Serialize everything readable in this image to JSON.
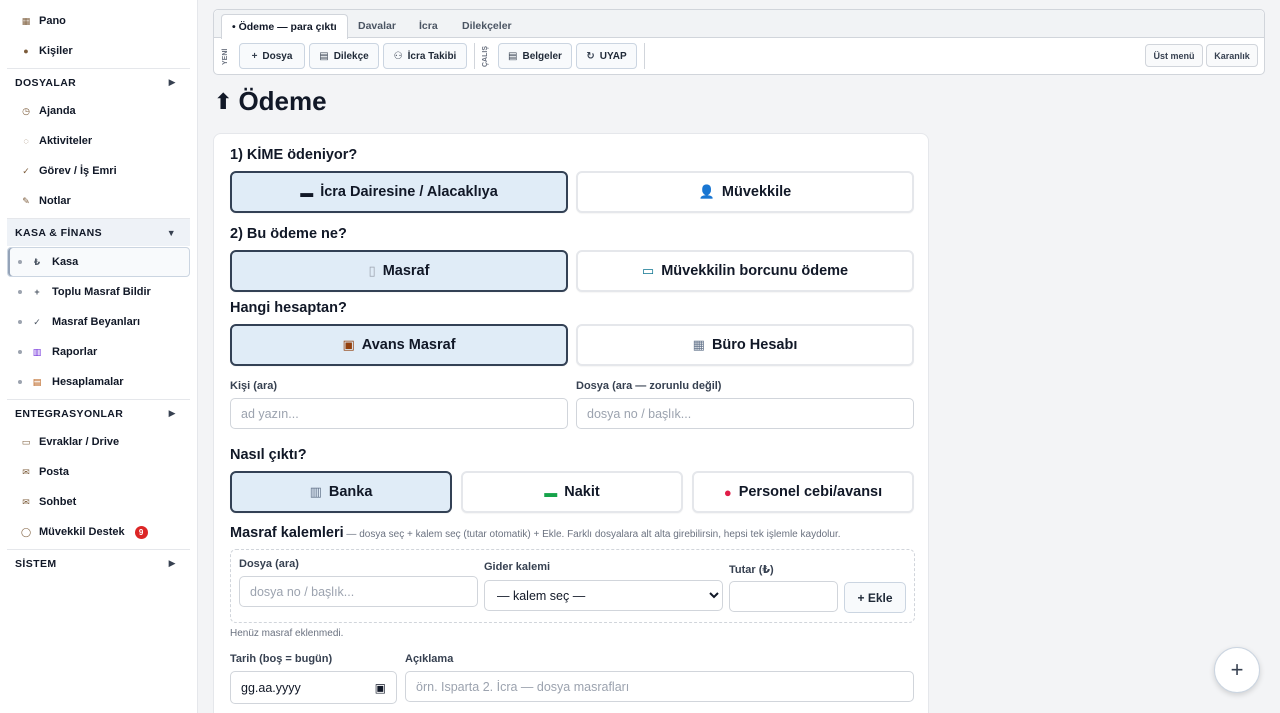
{
  "sidebar": {
    "top_items": [
      {
        "icon": "grid-icon",
        "glyph": "▦",
        "label": "Pano"
      },
      {
        "icon": "person-icon",
        "glyph": "●",
        "label": "Kişiler"
      }
    ],
    "sections": {
      "dosyalar": {
        "label": "DOSYALAR",
        "arrow": "▶"
      },
      "kasa": {
        "label": "KASA & FİNANS",
        "arrow": "▼"
      },
      "entegrasyonlar": {
        "label": "ENTEGRASYONLAR",
        "arrow": "▶"
      },
      "sistem": {
        "label": "SİSTEM",
        "arrow": "▶"
      }
    },
    "work_items": [
      {
        "icon": "clock-icon",
        "glyph": "◷",
        "label": "Ajanda"
      },
      {
        "icon": "activity-icon",
        "glyph": "◌",
        "label": "Aktiviteler"
      },
      {
        "icon": "check-icon",
        "glyph": "✓",
        "label": "Görev / İş Emri"
      },
      {
        "icon": "pencil-icon",
        "glyph": "✎",
        "label": "Notlar"
      }
    ],
    "finance_items": [
      {
        "icon": "wallet-icon",
        "glyph": "₺",
        "label": "Kasa"
      },
      {
        "icon": "plus-icon",
        "glyph": "+",
        "label": "Toplu Masraf Bildir"
      },
      {
        "icon": "check-icon",
        "glyph": "✓",
        "label": "Masraf Beyanları"
      },
      {
        "icon": "chart-icon",
        "glyph": "▥",
        "label": "Raporlar"
      },
      {
        "icon": "calculator-icon",
        "glyph": "▤",
        "label": "Hesaplamalar"
      }
    ],
    "integration_items": [
      {
        "icon": "folder-icon",
        "glyph": "▭",
        "label": "Evraklar / Drive"
      },
      {
        "icon": "mail-icon",
        "glyph": "✉",
        "label": "Posta"
      },
      {
        "icon": "chat-icon",
        "glyph": "✉",
        "label": "Sohbet"
      },
      {
        "icon": "support-icon",
        "glyph": "◯",
        "label": "Müvekkil Destek",
        "badge": "9"
      }
    ]
  },
  "topbar": {
    "tabs": [
      "• Ödeme — para çıktı",
      "Davalar",
      "İcra",
      "Dilekçeler"
    ],
    "group_labels": [
      "YENİ",
      "ÇALIŞ"
    ],
    "new_buttons": [
      {
        "icon": "plus-icon",
        "glyph": "+",
        "label": "Dosya"
      },
      {
        "icon": "document-icon",
        "glyph": "▤",
        "label": "Dilekçe"
      },
      {
        "icon": "binoculars-icon",
        "glyph": "⚇",
        "label": "İcra Takibi"
      }
    ],
    "work_buttons": [
      {
        "icon": "document-icon",
        "glyph": "▤",
        "label": "Belgeler"
      },
      {
        "icon": "refresh-icon",
        "glyph": "↻",
        "label": "UYAP"
      }
    ],
    "right_buttons": [
      "Üst menü",
      "Karanlık"
    ]
  },
  "page": {
    "title": "Ödeme",
    "title_icon": "⬆"
  },
  "form": {
    "q1": "1) KİME ödeniyor?",
    "q1_options": [
      {
        "icon": "tray-icon",
        "glyph": "▬",
        "label": "İcra Dairesine / Alacaklıya",
        "selected": true
      },
      {
        "icon": "user-icon",
        "glyph": "👤",
        "label": "Müvekkile",
        "selected": false
      }
    ],
    "q2": "2) Bu ödeme ne?",
    "q2_options": [
      {
        "icon": "receipt-icon",
        "glyph": "▯",
        "label": "Masraf",
        "selected": true
      },
      {
        "icon": "card-icon",
        "glyph": "▭",
        "label": "Müvekkilin borcunu ödeme",
        "selected": false
      }
    ],
    "q3": "Hangi hesaptan?",
    "q3_options": [
      {
        "icon": "briefcase-icon",
        "glyph": "▣",
        "label": "Avans Masraf",
        "selected": true
      },
      {
        "icon": "building-icon",
        "glyph": "▦",
        "label": "Büro Hesabı",
        "selected": false
      }
    ],
    "person_label": "Kişi (ara)",
    "person_placeholder": "ad yazın...",
    "file_label": "Dosya (ara — zorunlu değil)",
    "file_placeholder": "dosya no / başlık...",
    "q4": "Nasıl çıktı?",
    "q4_options": [
      {
        "icon": "bank-icon",
        "glyph": "▥",
        "label": "Banka",
        "selected": true
      },
      {
        "icon": "cash-icon",
        "glyph": "▬",
        "label": "Nakit",
        "selected": false
      },
      {
        "icon": "wallet-icon",
        "glyph": "●",
        "label": "Personel cebi/avansı",
        "selected": false
      }
    ],
    "expenses_title": "Masraf kalemleri",
    "expenses_hint": " — dosya seç + kalem seç (tutar otomatik) + Ekle. Farklı dosyalara alt alta girebilirsin, hepsi tek işlemle kaydolur.",
    "exp_file_label": "Dosya (ara)",
    "exp_file_placeholder": "dosya no / başlık...",
    "exp_item_label": "Gider kalemi",
    "exp_item_selected": "— kalem seç —",
    "exp_amount_label": "Tutar (₺)",
    "exp_add_button": "+ Ekle",
    "no_expense_note": "Henüz masraf eklenmedi.",
    "date_label": "Tarih (boş = bugün)",
    "date_placeholder": "gg.aa.yyyy",
    "desc_label": "Açıklama",
    "desc_placeholder": "örn. Isparta 2. İcra — dosya masrafları"
  },
  "fab": "+"
}
